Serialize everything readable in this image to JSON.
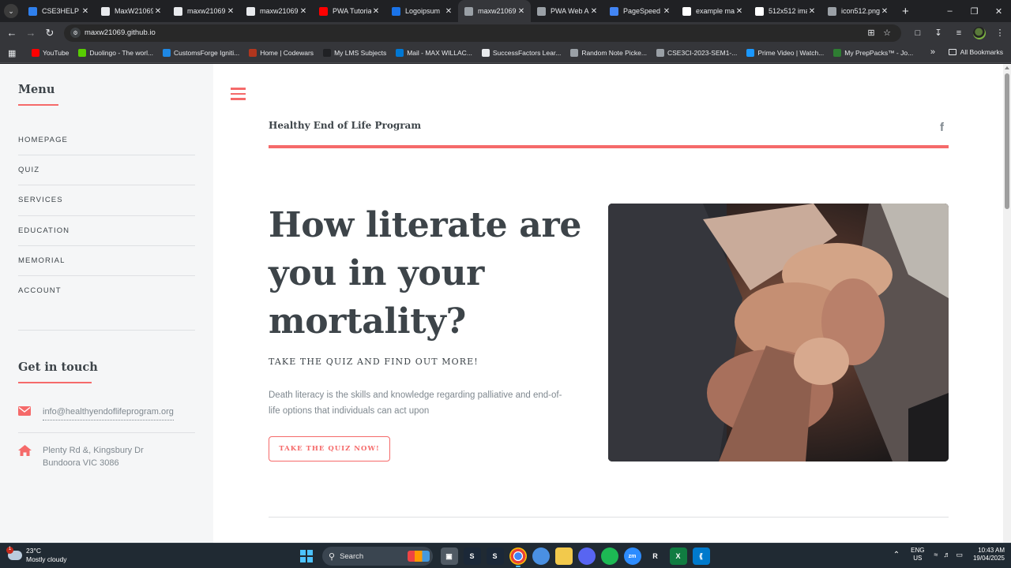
{
  "browser": {
    "tabs": [
      {
        "title": "CSE3HELP G",
        "icon": "vscode-icon",
        "color": "#2f80ed"
      },
      {
        "title": "MaxW21069",
        "icon": "github-icon",
        "color": "#e8eaed"
      },
      {
        "title": "maxw21069.",
        "icon": "github-icon",
        "color": "#e8eaed"
      },
      {
        "title": "maxw21069.",
        "icon": "github-icon",
        "color": "#e8eaed"
      },
      {
        "title": "PWA Tutoria",
        "icon": "youtube-icon",
        "color": "#ff0000"
      },
      {
        "title": "Logoipsum",
        "icon": "logo-icon",
        "color": "#1a73e8"
      },
      {
        "title": "maxw21069.",
        "icon": "globe-icon",
        "color": "#9aa0a6",
        "active": true
      },
      {
        "title": "PWA Web A",
        "icon": "globe-icon",
        "color": "#9aa0a6"
      },
      {
        "title": "PageSpeed I",
        "icon": "pagespeed-icon",
        "color": "#4285f4"
      },
      {
        "title": "example ma",
        "icon": "google-icon",
        "color": "#ffffff"
      },
      {
        "title": "512x512 ima",
        "icon": "google-icon",
        "color": "#ffffff"
      },
      {
        "title": "icon512.png",
        "icon": "image-icon",
        "color": "#9aa0a6"
      }
    ],
    "url": "maxw21069.github.io",
    "bookmarks": [
      {
        "label": "YouTube",
        "color": "#ff0000"
      },
      {
        "label": "Duolingo - The worl...",
        "color": "#58cc02"
      },
      {
        "label": "CustomsForge Igniti...",
        "color": "#1e88e5"
      },
      {
        "label": "Home | Codewars",
        "color": "#b1361e"
      },
      {
        "label": "My LMS Subjects",
        "color": "#202124"
      },
      {
        "label": "Mail - MAX WILLAC...",
        "color": "#0078d4"
      },
      {
        "label": "SuccessFactors Lear...",
        "color": "#e8eaed"
      },
      {
        "label": "Random Note Picke...",
        "color": "#9aa0a6"
      },
      {
        "label": "CSE3CI-2023-SEM1-...",
        "color": "#9aa0a6"
      },
      {
        "label": "Prime Video | Watch...",
        "color": "#1a98ff"
      },
      {
        "label": "My PrepPacks™ - Jo...",
        "color": "#2e7d32"
      }
    ],
    "all_bookmarks": "All Bookmarks"
  },
  "sidebar": {
    "menu_heading": "Menu",
    "menu_items": [
      "HOMEPAGE",
      "QUIZ",
      "SERVICES",
      "EDUCATION",
      "MEMORIAL",
      "ACCOUNT"
    ],
    "contact_heading": "Get in touch",
    "email": "info@healthyendoflifeprogram.org",
    "address_line1": "Plenty Rd &, Kingsbury Dr",
    "address_line2": "Bundoora VIC 3086"
  },
  "header": {
    "site_title": "Healthy End of Life Program",
    "social_icon": "f"
  },
  "hero": {
    "title": "How literate are you in your mortality?",
    "subtitle": "TAKE THE QUIZ AND FIND OUT MORE!",
    "text": "Death literacy is the skills and knowledge regarding palliative and end-of-life options that individuals can act upon",
    "button": "TAKE THE QUIZ NOW!"
  },
  "taskbar": {
    "weather_temp": "23°C",
    "weather_desc": "Mostly cloudy",
    "weather_badge": "1",
    "search": "Search",
    "lang1": "ENG",
    "lang2": "US",
    "time": "10:43 AM",
    "date": "19/04/2025"
  },
  "colors": {
    "accent": "#f56a6a",
    "text": "#3d4449",
    "muted": "#7f888f",
    "sidebar_bg": "#f5f6f7"
  }
}
